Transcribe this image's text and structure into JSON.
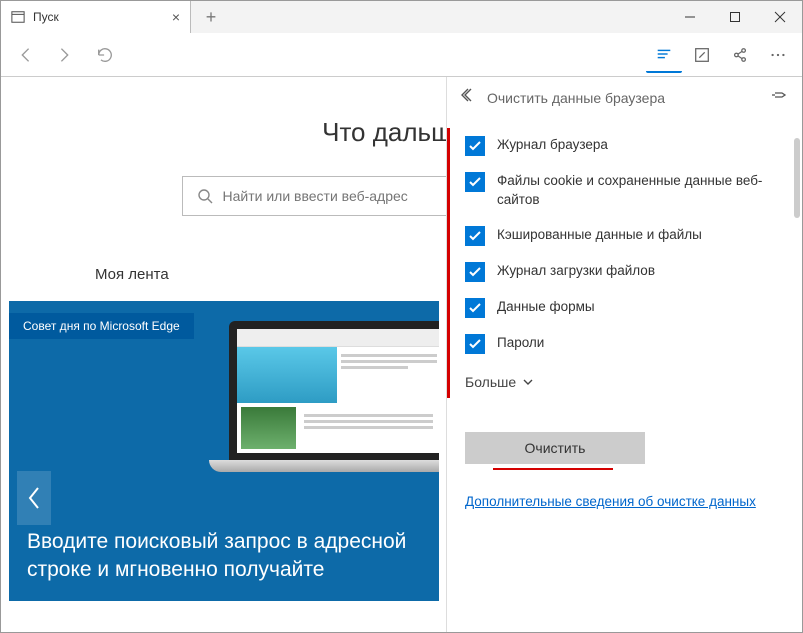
{
  "tab": {
    "title": "Пуск"
  },
  "page": {
    "headline": "Что дальше?",
    "search_placeholder": "Найти или ввести веб-адрес",
    "feed_title": "Моя лента"
  },
  "tile": {
    "badge": "Совет дня по Microsoft Edge",
    "text_line1": "Вводите поисковый запрос в адресной",
    "text_line2": "строке и мгновенно получайте"
  },
  "panel": {
    "title": "Очистить данные браузера",
    "items": [
      "Журнал браузера",
      "Файлы cookie и сохраненные данные веб-сайтов",
      "Кэшированные данные и файлы",
      "Журнал загрузки файлов",
      "Данные формы",
      "Пароли"
    ],
    "more": "Больше",
    "clear": "Очистить",
    "info": "Дополнительные сведения об очистке данных"
  }
}
